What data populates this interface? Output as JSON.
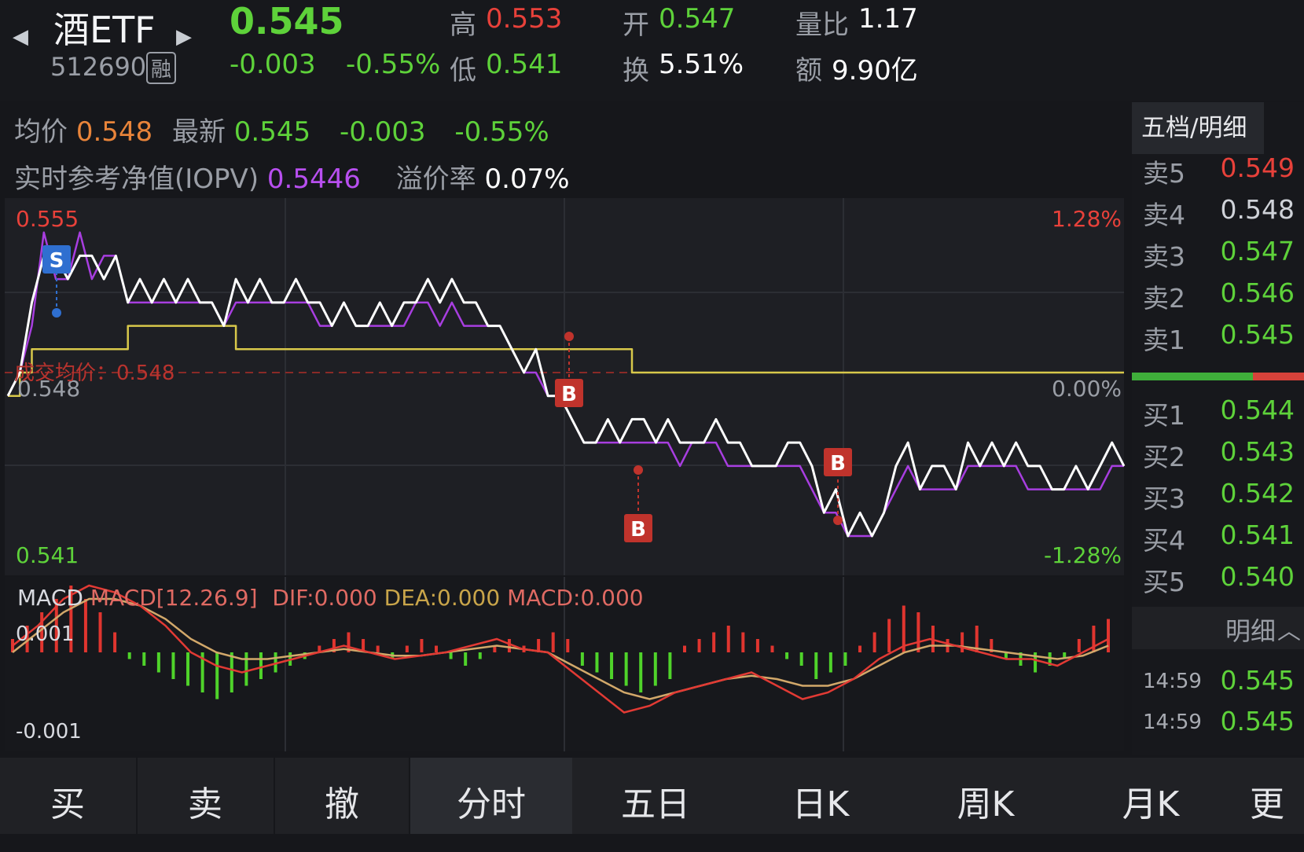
{
  "header": {
    "name": "酒ETF",
    "code": "512690",
    "margin_badge": "融",
    "price": "0.545",
    "change": "-0.003",
    "change_pct": "-0.55%",
    "high_label": "高",
    "high": "0.553",
    "low_label": "低",
    "low": "0.541",
    "open_label": "开",
    "open": "0.547",
    "turnover_label": "换",
    "turnover": "5.51%",
    "vol_ratio_label": "量比",
    "vol_ratio": "1.17",
    "amount_label": "额",
    "amount": "9.90亿"
  },
  "info": {
    "avg_label": "均价",
    "avg": "0.548",
    "latest_label": "最新",
    "latest": "0.545",
    "change": "-0.003",
    "change_pct": "-0.55%",
    "iopv_label": "实时参考净值(IOPV)",
    "iopv": "0.5446",
    "premium_label": "溢价率",
    "premium": "0.07%"
  },
  "chart_labels": {
    "y_top": "0.555",
    "y_mid": "0.548",
    "y_bottom": "0.541",
    "pct_top": "1.28%",
    "pct_mid": "0.00%",
    "pct_bottom": "-1.28%",
    "avg_line_label": "成交均价：0.548",
    "marker_s": "S",
    "marker_b": "B"
  },
  "macd": {
    "label": "MACD",
    "params": "MACD[12.26.9]",
    "dif": "DIF:0.000",
    "dea": "DEA:0.000",
    "macd": "MACD:0.000",
    "y_top": "0.001",
    "y_bottom": "-0.001"
  },
  "order_book": {
    "tab": "五档/明细",
    "asks": [
      {
        "label": "卖5",
        "price": "0.549",
        "color": "#e8413a"
      },
      {
        "label": "卖4",
        "price": "0.548",
        "color": "#cfd2d8"
      },
      {
        "label": "卖3",
        "price": "0.547",
        "color": "#5ed23a"
      },
      {
        "label": "卖2",
        "price": "0.546",
        "color": "#5ed23a"
      },
      {
        "label": "卖1",
        "price": "0.545",
        "color": "#5ed23a"
      }
    ],
    "bids": [
      {
        "label": "买1",
        "price": "0.544",
        "color": "#5ed23a"
      },
      {
        "label": "买2",
        "price": "0.543",
        "color": "#5ed23a"
      },
      {
        "label": "买3",
        "price": "0.542",
        "color": "#5ed23a"
      },
      {
        "label": "买4",
        "price": "0.541",
        "color": "#5ed23a"
      },
      {
        "label": "买5",
        "price": "0.540",
        "color": "#5ed23a"
      }
    ],
    "detail_label": "明细",
    "details": [
      {
        "time": "14:59",
        "price": "0.545"
      },
      {
        "time": "14:59",
        "price": "0.545"
      }
    ]
  },
  "bottom_bar": {
    "buy": "买",
    "sell": "卖",
    "cancel": "撤",
    "tabs": [
      "分时",
      "五日",
      "日K",
      "周K",
      "月K",
      "更"
    ]
  },
  "chart_data": {
    "type": "line",
    "title": "",
    "ylim": [
      0.541,
      0.555
    ],
    "series": [
      {
        "values": [
          0.547,
          0.548,
          0.551,
          0.553,
          0.553,
          0.552,
          0.553,
          0.553,
          0.552,
          0.553,
          0.551,
          0.552,
          0.551,
          0.552,
          0.551,
          0.552,
          0.551,
          0.551,
          0.55,
          0.552,
          0.551,
          0.552,
          0.551,
          0.551,
          0.552,
          0.551,
          0.551,
          0.55,
          0.551,
          0.55,
          0.55,
          0.551,
          0.55,
          0.551,
          0.551,
          0.552,
          0.551,
          0.552,
          0.551,
          0.551,
          0.55,
          0.55,
          0.549,
          0.548,
          0.549,
          0.547,
          0.547,
          0.546,
          0.545,
          0.545,
          0.546,
          0.545,
          0.546,
          0.546,
          0.545,
          0.546,
          0.545,
          0.545,
          0.545,
          0.546,
          0.545,
          0.545,
          0.544,
          0.544,
          0.544,
          0.545,
          0.545,
          0.544,
          0.542,
          0.543,
          0.541,
          0.542,
          0.541,
          0.542,
          0.544,
          0.545,
          0.543,
          0.544,
          0.544,
          0.543,
          0.545,
          0.544,
          0.545,
          0.544,
          0.545,
          0.544,
          0.544,
          0.543,
          0.543,
          0.544,
          0.543,
          0.544,
          0.545,
          0.544
        ]
      },
      {
        "values": [
          0.547,
          0.548,
          0.55,
          0.554,
          0.552,
          0.552,
          0.554,
          0.552,
          0.553,
          0.553,
          0.551,
          0.551,
          0.551,
          0.551,
          0.551,
          0.551,
          0.551,
          0.551,
          0.55,
          0.551,
          0.551,
          0.551,
          0.551,
          0.551,
          0.551,
          0.551,
          0.55,
          0.55,
          0.551,
          0.55,
          0.55,
          0.55,
          0.55,
          0.55,
          0.551,
          0.551,
          0.55,
          0.551,
          0.55,
          0.55,
          0.55,
          0.55,
          0.549,
          0.548,
          0.548,
          0.547,
          0.547,
          0.546,
          0.545,
          0.545,
          0.545,
          0.545,
          0.545,
          0.545,
          0.545,
          0.545,
          0.544,
          0.545,
          0.545,
          0.545,
          0.544,
          0.544,
          0.544,
          0.544,
          0.544,
          0.544,
          0.544,
          0.543,
          0.542,
          0.542,
          0.541,
          0.541,
          0.541,
          0.542,
          0.543,
          0.544,
          0.543,
          0.543,
          0.543,
          0.543,
          0.544,
          0.544,
          0.544,
          0.544,
          0.544,
          0.543,
          0.543,
          0.543,
          0.543,
          0.543,
          0.543,
          0.543,
          0.544,
          0.544
        ]
      },
      {
        "values": [
          0.547,
          0.548,
          0.549,
          0.549,
          0.549,
          0.549,
          0.549,
          0.549,
          0.549,
          0.549,
          0.55,
          0.55,
          0.55,
          0.55,
          0.55,
          0.55,
          0.55,
          0.55,
          0.55,
          0.549,
          0.549,
          0.549,
          0.549,
          0.549,
          0.549,
          0.549,
          0.549,
          0.549,
          0.549,
          0.549,
          0.549,
          0.549,
          0.549,
          0.549,
          0.549,
          0.549,
          0.549,
          0.549,
          0.549,
          0.549,
          0.549,
          0.549,
          0.549,
          0.549,
          0.549,
          0.549,
          0.549,
          0.549,
          0.549,
          0.549,
          0.549,
          0.549,
          0.548,
          0.548,
          0.548,
          0.548,
          0.548,
          0.548,
          0.548,
          0.548,
          0.548,
          0.548,
          0.548,
          0.548,
          0.548,
          0.548,
          0.548,
          0.548,
          0.548,
          0.548,
          0.548,
          0.548,
          0.548,
          0.548,
          0.548,
          0.548,
          0.548,
          0.548,
          0.548,
          0.548,
          0.548,
          0.548,
          0.548,
          0.548,
          0.548,
          0.548,
          0.548,
          0.548,
          0.548,
          0.548,
          0.548,
          0.548,
          0.548,
          0.548
        ]
      }
    ],
    "macd": {
      "ylim": [
        -0.0012,
        0.0012
      ],
      "hist": [
        0.2,
        0.4,
        0.6,
        0.8,
        1.0,
        0.8,
        0.6,
        0.3,
        -0.1,
        -0.2,
        -0.3,
        -0.4,
        -0.5,
        -0.6,
        -0.7,
        -0.6,
        -0.5,
        -0.4,
        -0.3,
        -0.2,
        -0.1,
        0.1,
        0.2,
        0.3,
        0.2,
        0.1,
        -0.1,
        0.1,
        0.2,
        0.1,
        -0.1,
        -0.2,
        -0.1,
        0.1,
        0.2,
        0.1,
        0.2,
        0.3,
        0.2,
        -0.2,
        -0.3,
        -0.4,
        -0.5,
        -0.6,
        -0.5,
        -0.4,
        0.1,
        0.2,
        0.3,
        0.4,
        0.3,
        0.2,
        0.1,
        -0.1,
        -0.2,
        -0.4,
        -0.3,
        -0.2,
        0.1,
        0.3,
        0.5,
        0.7,
        0.6,
        0.4,
        0.2,
        0.3,
        0.4,
        0.2,
        -0.1,
        -0.2,
        -0.3,
        -0.2,
        -0.1,
        0.2,
        0.4,
        0.5
      ],
      "dif": [
        0.1,
        0.4,
        0.8,
        1.0,
        0.9,
        0.7,
        0.4,
        0.0,
        -0.2,
        -0.3,
        -0.2,
        -0.1,
        0.0,
        0.1,
        0.0,
        -0.1,
        -0.05,
        0.0,
        0.1,
        0.2,
        0.05,
        0.0,
        -0.3,
        -0.6,
        -0.9,
        -0.8,
        -0.6,
        -0.5,
        -0.4,
        -0.3,
        -0.5,
        -0.7,
        -0.6,
        -0.4,
        -0.1,
        0.1,
        0.2,
        0.1,
        0.0,
        -0.1,
        -0.1,
        -0.2,
        0.0,
        0.2
      ],
      "dea": [
        0.0,
        0.3,
        0.6,
        0.8,
        0.8,
        0.7,
        0.5,
        0.2,
        0.0,
        -0.1,
        -0.1,
        -0.05,
        0.0,
        0.05,
        0.0,
        -0.05,
        -0.05,
        0.0,
        0.05,
        0.1,
        0.05,
        0.0,
        -0.2,
        -0.4,
        -0.6,
        -0.7,
        -0.6,
        -0.5,
        -0.4,
        -0.35,
        -0.4,
        -0.5,
        -0.5,
        -0.4,
        -0.2,
        0.0,
        0.1,
        0.1,
        0.05,
        0.0,
        -0.05,
        -0.1,
        -0.05,
        0.1
      ]
    }
  }
}
